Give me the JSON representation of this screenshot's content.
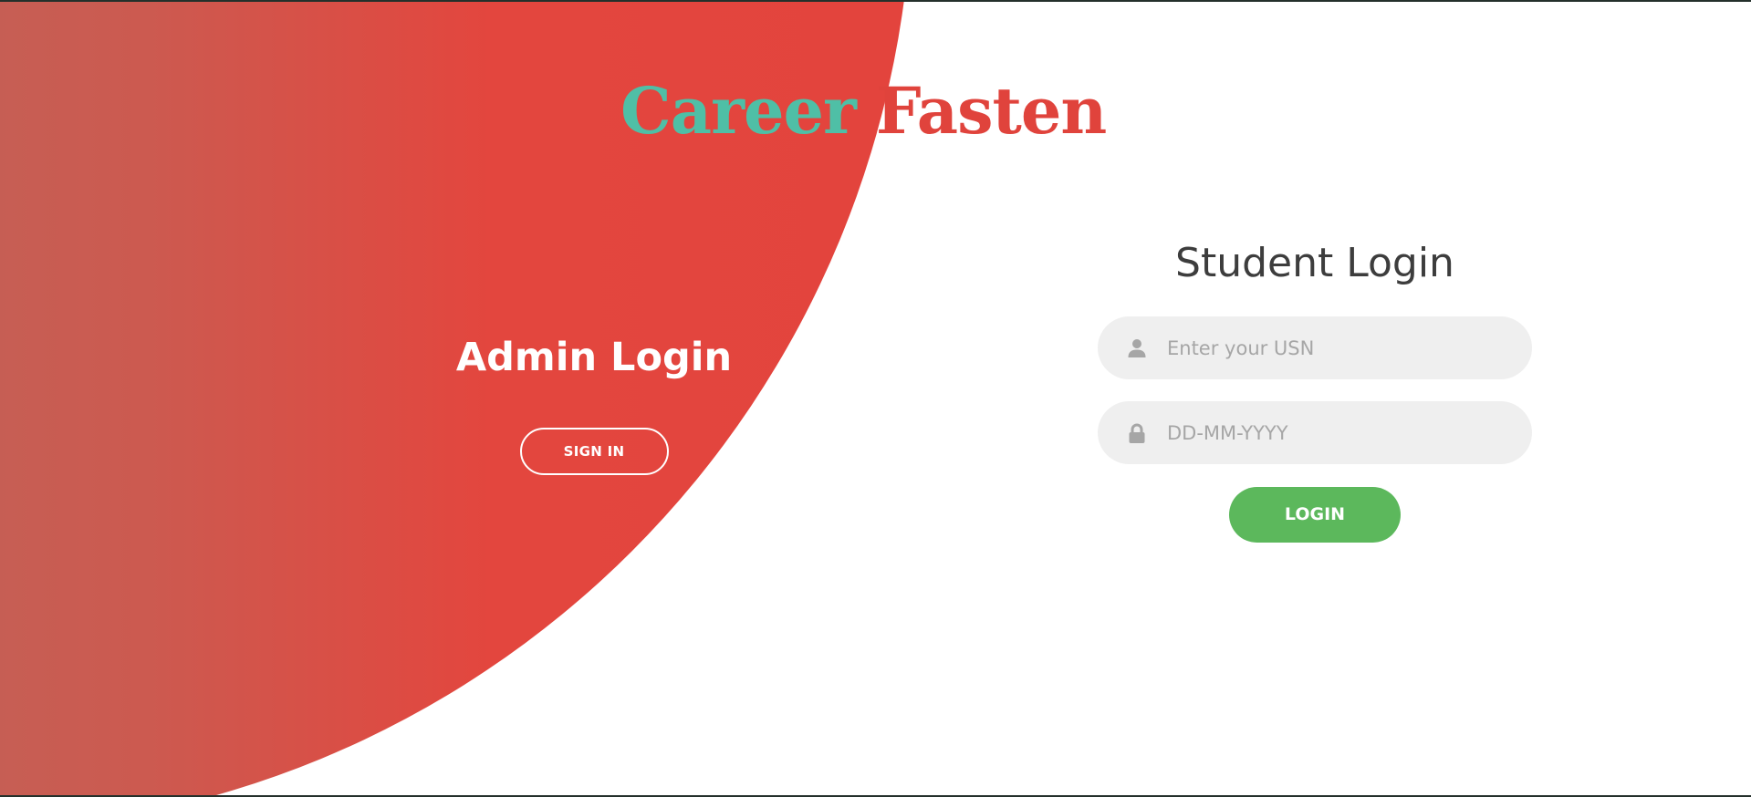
{
  "brand": {
    "part1": "Career",
    "part2": "Fasten"
  },
  "admin": {
    "title": "Admin Login",
    "signin_label": "SIGN IN"
  },
  "student": {
    "title": "Student Login",
    "usn_placeholder": "Enter your USN",
    "usn_value": "",
    "dob_placeholder": "DD-MM-YYYY",
    "dob_value": "",
    "login_label": "LOGIN",
    "user_icon": "user-icon",
    "lock_icon": "lock-icon"
  },
  "colors": {
    "brand_teal": "#4fbfa6",
    "brand_red": "#e0433c",
    "panel_gradient_start": "#a57b6c",
    "panel_gradient_end": "#e3443d",
    "login_green": "#5cb85c",
    "field_bg": "#efefef"
  }
}
